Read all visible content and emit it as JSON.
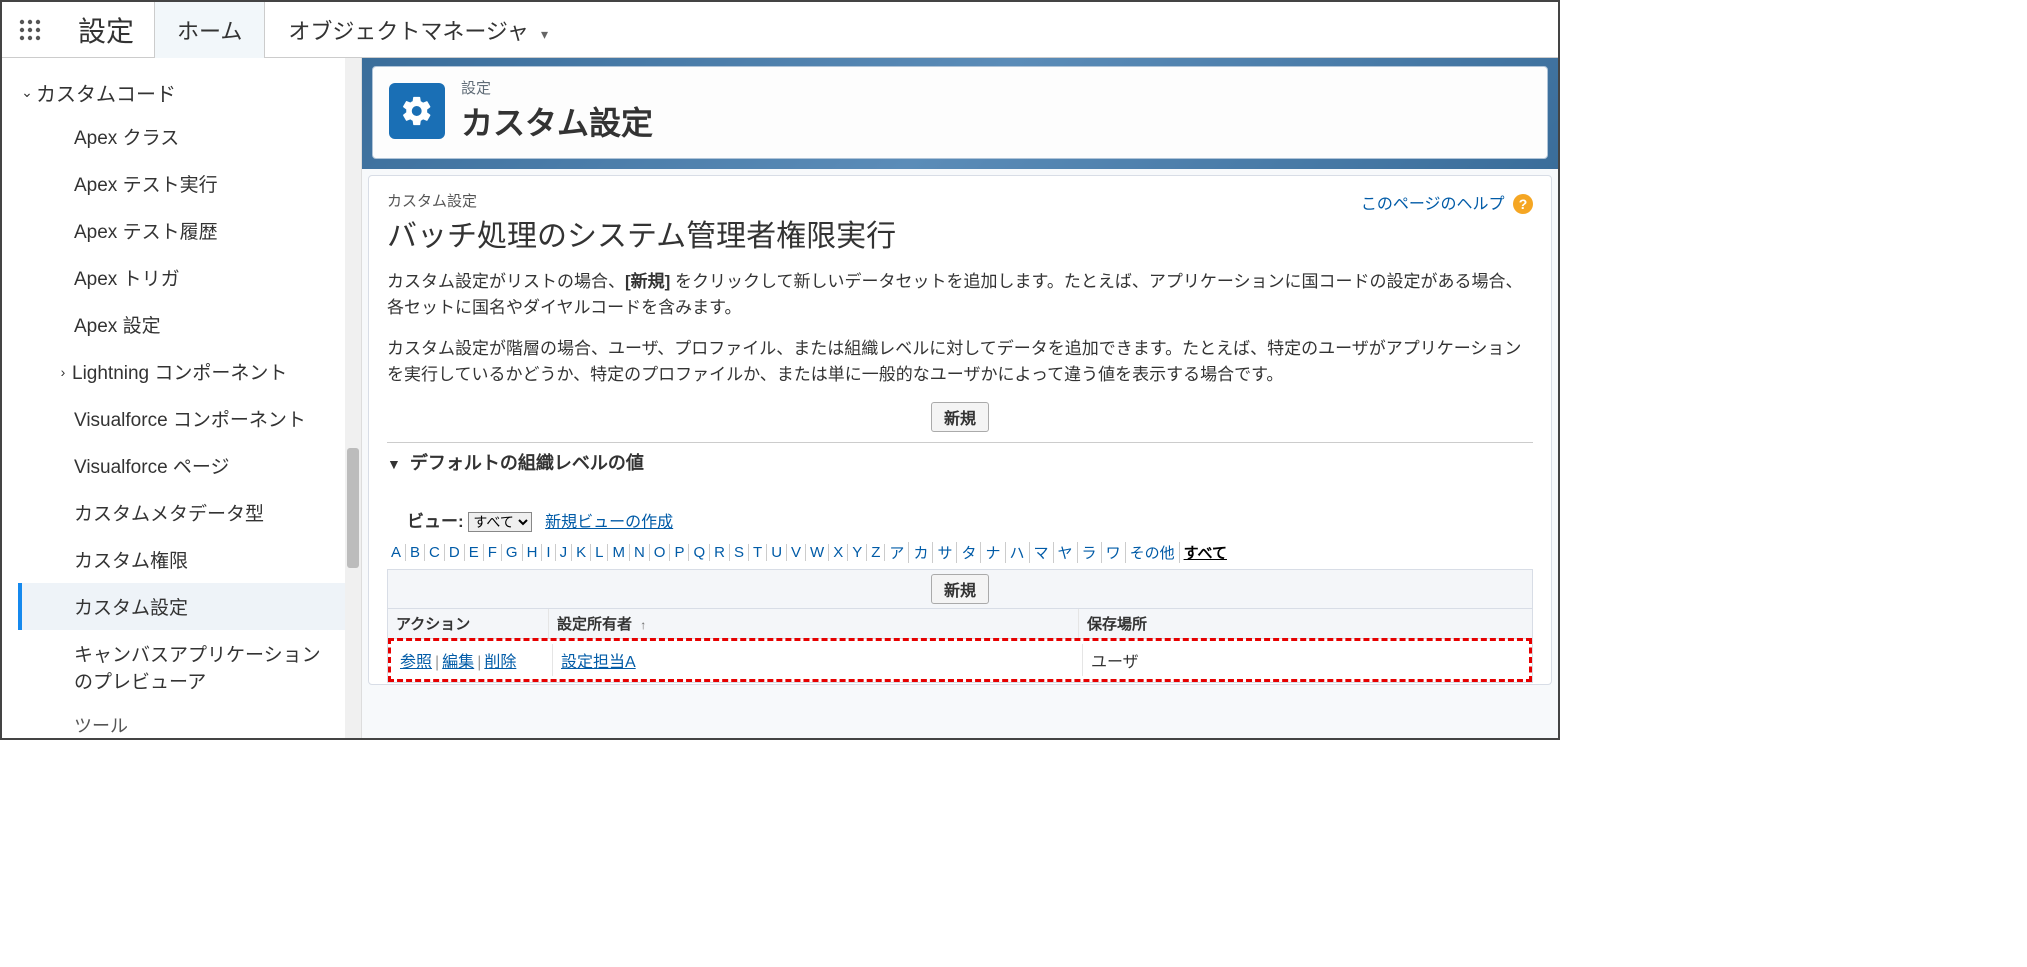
{
  "topnav": {
    "app": "設定",
    "tabs": [
      {
        "label": "ホーム",
        "active": true
      },
      {
        "label": "オブジェクトマネージャ",
        "dropdown": true
      }
    ]
  },
  "sidebar": {
    "group": {
      "label": "カスタムコード"
    },
    "items": [
      {
        "label": "Apex クラス"
      },
      {
        "label": "Apex テスト実行"
      },
      {
        "label": "Apex テスト履歴"
      },
      {
        "label": "Apex トリガ"
      },
      {
        "label": "Apex 設定"
      },
      {
        "label": "Lightning コンポーネント",
        "expandable": true
      },
      {
        "label": "Visualforce コンポーネント"
      },
      {
        "label": "Visualforce ページ"
      },
      {
        "label": "カスタムメタデータ型"
      },
      {
        "label": "カスタム権限"
      },
      {
        "label": "カスタム設定",
        "active": true
      },
      {
        "label": "キャンバスアプリケーションのプレビューア"
      },
      {
        "label": "ツール",
        "truncated": true
      }
    ]
  },
  "header": {
    "crumb": "設定",
    "title": "カスタム設定"
  },
  "page": {
    "help": "このページのヘルプ",
    "section_crumb": "カスタム設定",
    "section_title": "バッチ処理のシステム管理者権限実行",
    "desc1_a": "カスタム設定がリストの場合、",
    "desc1_b": "[新規]",
    "desc1_c": " をクリックして新しいデータセットを追加します。たとえば、アプリケーションに国コードの設定がある場合、各セットに国名やダイヤルコードを含みます。",
    "desc2": "カスタム設定が階層の場合、ユーザ、プロファイル、または組織レベルに対してデータを追加できます。たとえば、特定のユーザがアプリケーションを実行しているかどうか、特定のプロファイルか、または単に一般的なユーザかによって違う値を表示する場合です。",
    "new_btn": "新規",
    "collapse": "デフォルトの組織レベルの値",
    "view_label": "ビュー:",
    "view_options": [
      "すべて"
    ],
    "create_view": "新規ビューの作成",
    "alphabet": [
      "A",
      "B",
      "C",
      "D",
      "E",
      "F",
      "G",
      "H",
      "I",
      "J",
      "K",
      "L",
      "M",
      "N",
      "O",
      "P",
      "Q",
      "R",
      "S",
      "T",
      "U",
      "V",
      "W",
      "X",
      "Y",
      "Z",
      "ア",
      "カ",
      "サ",
      "タ",
      "ナ",
      "ハ",
      "マ",
      "ヤ",
      "ラ",
      "ワ",
      "その他",
      "すべて"
    ],
    "alphabet_selected": "すべて",
    "table": {
      "new": "新規",
      "headers": {
        "action": "アクション",
        "owner": "設定所有者",
        "location": "保存場所"
      },
      "actions": {
        "view": "参照",
        "edit": "編集",
        "del": "削除"
      },
      "row": {
        "owner": "設定担当A",
        "location": "ユーザ"
      }
    }
  }
}
